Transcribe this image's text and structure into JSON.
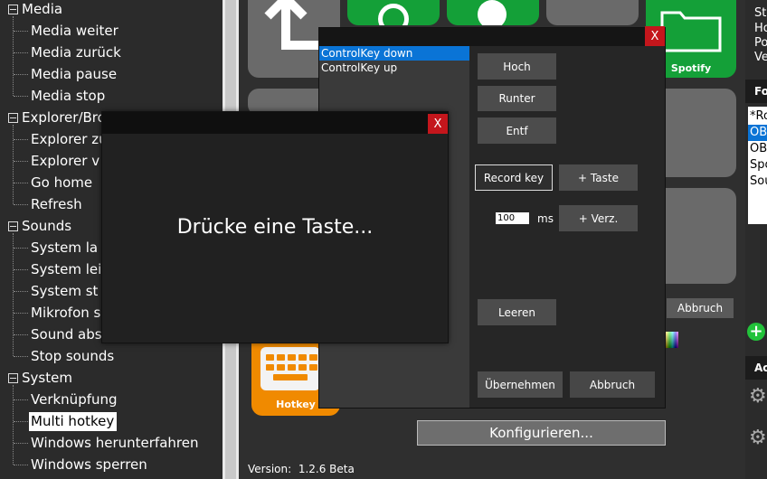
{
  "tree": {
    "groups": [
      {
        "label": "Media",
        "items": [
          "Media weiter",
          "Media zurück",
          "Media pause",
          "Media stop"
        ]
      },
      {
        "label": "Explorer/Brow",
        "items": [
          "Explorer zu",
          "Explorer v",
          "Go home",
          "Refresh"
        ]
      },
      {
        "label": "Sounds",
        "items": [
          "System la",
          "System lei",
          "System st",
          "Mikrofon s",
          "Sound abs",
          "Stop sounds"
        ]
      },
      {
        "label": "System",
        "items": [
          "Verknüpfung",
          "Multi hotkey",
          "Windows herunterfahren",
          "Windows sperren"
        ]
      }
    ],
    "selected_item": "Multi hotkey"
  },
  "main": {
    "tiles": {
      "spotify_label": "Spotify",
      "hotkey_label": "Hotkey"
    },
    "configure_button": "Konfigurieren...",
    "cancel_button_behind": "Abbruch",
    "version_label": "Version:",
    "version_value": "1.2.6 Beta"
  },
  "right_panel": {
    "top_lines": [
      "St",
      "Ho",
      "Po",
      "Ve"
    ],
    "list_header": "Fo",
    "list_items": [
      "*Ro",
      "OB",
      "OB",
      "Spo",
      "Sou"
    ],
    "list_selected_index": 1,
    "bottom_header": "Ac",
    "icons": [
      "plus-icon",
      "gear-icon",
      "gear-icon"
    ]
  },
  "editor": {
    "key_list": [
      "ControlKey down",
      "ControlKey up"
    ],
    "selected_index": 0,
    "close_label": "X",
    "buttons": {
      "up": "Hoch",
      "down": "Runter",
      "delete": "Entf",
      "record": "Record key",
      "add_key": "+ Taste",
      "add_delay": "+ Verz.",
      "clear": "Leeren",
      "apply": "Übernehmen",
      "cancel": "Abbruch"
    },
    "delay_value": "100",
    "delay_unit": "ms"
  },
  "press_dialog": {
    "close_label": "X",
    "message": "Drücke eine Taste..."
  },
  "colors": {
    "accent": "#0a74d6",
    "close_red": "#c4161c",
    "tile_green": "#14a038",
    "tile_orange": "#f08a00",
    "plus_green": "#22c23a"
  }
}
